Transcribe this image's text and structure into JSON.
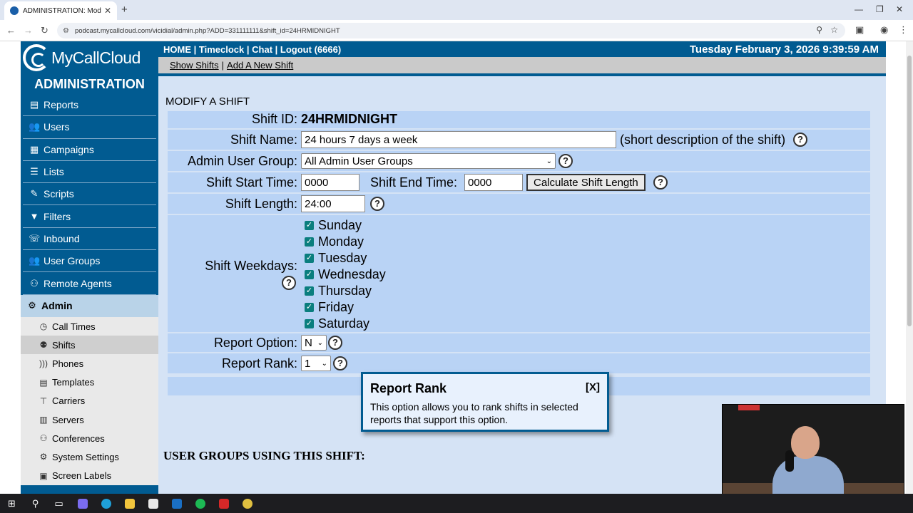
{
  "browser": {
    "tab_title": "ADMINISTRATION: Modify Shift",
    "url": "podcast.mycallcloud.com/vicidial/admin.php?ADD=331111111&shift_id=24HRMIDNIGHT"
  },
  "sidebar": {
    "logo_text": "MyCallCloud",
    "title": "ADMINISTRATION",
    "items": [
      {
        "label": "Reports",
        "icon": "reports-icon"
      },
      {
        "label": "Users",
        "icon": "users-icon"
      },
      {
        "label": "Campaigns",
        "icon": "campaigns-icon"
      },
      {
        "label": "Lists",
        "icon": "lists-icon"
      },
      {
        "label": "Scripts",
        "icon": "scripts-icon"
      },
      {
        "label": "Filters",
        "icon": "filter-icon"
      },
      {
        "label": "Inbound",
        "icon": "inbound-icon"
      },
      {
        "label": "User Groups",
        "icon": "user-groups-icon"
      },
      {
        "label": "Remote Agents",
        "icon": "remote-agents-icon"
      },
      {
        "label": "Admin",
        "icon": "gear-icon"
      }
    ],
    "subitems": [
      {
        "label": "Call Times"
      },
      {
        "label": "Shifts"
      },
      {
        "label": "Phones"
      },
      {
        "label": "Templates"
      },
      {
        "label": "Carriers"
      },
      {
        "label": "Servers"
      },
      {
        "label": "Conferences"
      },
      {
        "label": "System Settings"
      },
      {
        "label": "Screen Labels"
      }
    ]
  },
  "header": {
    "home": "HOME",
    "timeclock": "Timeclock",
    "chat": "Chat",
    "logout": "Logout (6666)",
    "sep": "|",
    "datetime": "Tuesday February 3, 2026 9:39:59 AM"
  },
  "subnav": {
    "show_shifts": "Show Shifts",
    "add_shift": "Add A New Shift",
    "sep": "|"
  },
  "form": {
    "section_title": "MODIFY A SHIFT",
    "shift_id_label": "Shift ID:",
    "shift_id_value": "24HRMIDNIGHT",
    "shift_name_label": "Shift Name:",
    "shift_name_value": "24 hours 7 days a week",
    "shift_name_note": "(short description of the shift)",
    "admin_group_label": "Admin User Group:",
    "admin_group_value": "All Admin User Groups",
    "start_label": "Shift Start Time:",
    "start_value": "0000",
    "end_label": "Shift End Time:",
    "end_value": "0000",
    "calc_button": "Calculate Shift Length",
    "length_label": "Shift Length:",
    "length_value": "24:00",
    "weekdays_label": "Shift Weekdays:",
    "weekdays": [
      "Sunday",
      "Monday",
      "Tuesday",
      "Wednesday",
      "Thursday",
      "Friday",
      "Saturday"
    ],
    "report_option_label": "Report Option:",
    "report_option_value": "N",
    "report_rank_label": "Report Rank:",
    "report_rank_value": "1",
    "help_glyph": "?",
    "check_glyph": "✓"
  },
  "users_section_title": "USER GROUPS USING THIS SHIFT:",
  "tooltip": {
    "title": "Report Rank",
    "close": "[X]",
    "body": "This option allows you to rank shifts in selected reports that support this option."
  },
  "colors": {
    "brand": "#015b91",
    "content_bg": "#d5e3f5",
    "row_bg": "#b9d3f5",
    "checkbox": "#0a7e7e"
  }
}
